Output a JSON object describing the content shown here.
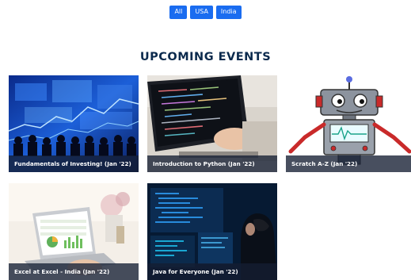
{
  "filters": [
    {
      "label": "All"
    },
    {
      "label": "USA"
    },
    {
      "label": "India"
    }
  ],
  "section": {
    "title": "UPCOMING EVENTS"
  },
  "events": [
    {
      "caption": "Fundamentals of Investing! (Jan '22)",
      "image_icon": "stock-market-audience-icon"
    },
    {
      "caption": "Introduction to Python (Jan '22)",
      "image_icon": "laptop-code-icon"
    },
    {
      "caption": "Scratch A-Z (Jan '22)",
      "image_icon": "robot-icon"
    },
    {
      "caption": "Excel at Excel - India (Jan '22)",
      "image_icon": "laptop-spreadsheet-icon"
    },
    {
      "caption": "Java for Everyone (Jan '22)",
      "image_icon": "developer-monitors-icon"
    }
  ],
  "colors": {
    "accent": "#1a6cf0",
    "title": "#0b2a4d",
    "caption_bg": "#1e2a40"
  }
}
